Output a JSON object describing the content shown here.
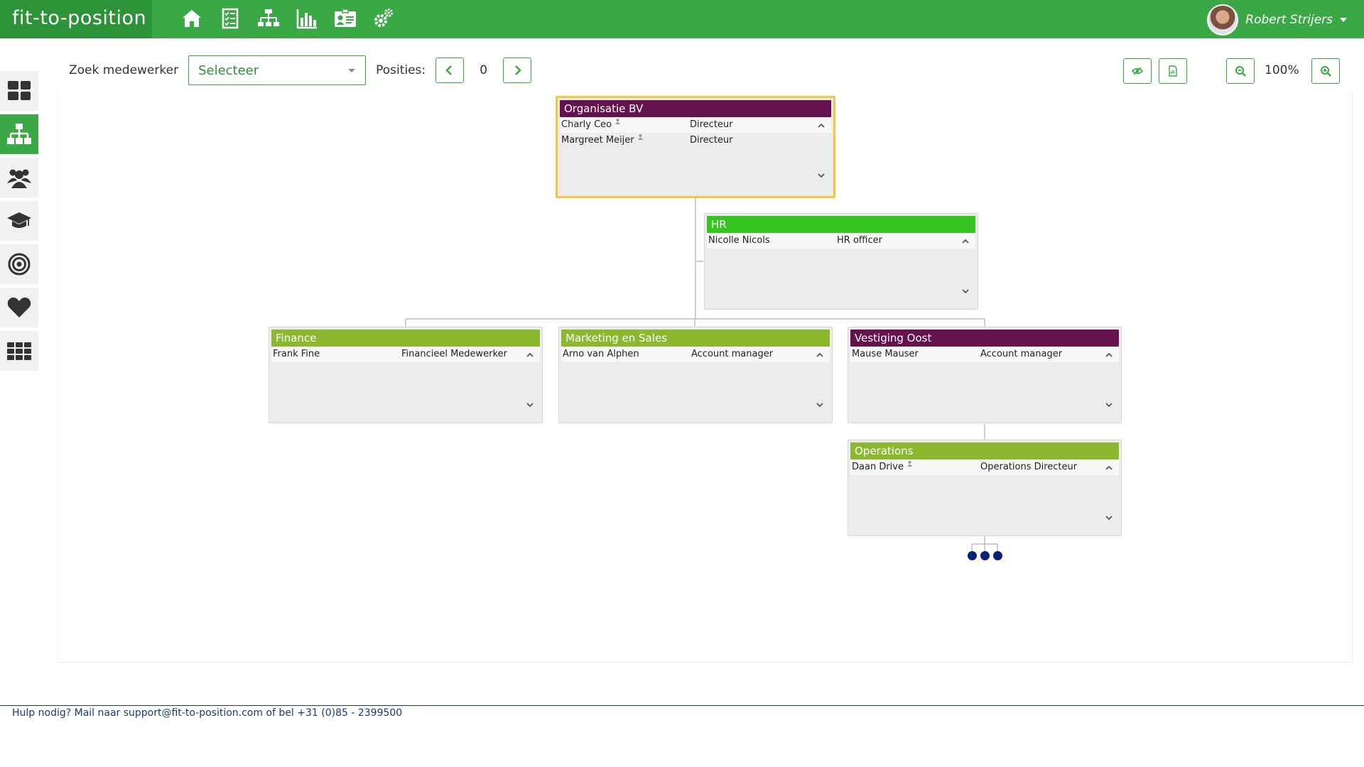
{
  "app": {
    "logo_text": "fit-to-position",
    "accent": "#3aa845",
    "accent_dark": "#2c9338"
  },
  "top_nav": {
    "icons": [
      "home-icon",
      "checklist-icon",
      "orgchart-icon",
      "bar-chart-icon",
      "id-card-icon",
      "gears-icon"
    ]
  },
  "user": {
    "name": "Robert Strijers"
  },
  "sidebar": {
    "items": [
      {
        "icon": "dashboard-icon",
        "active": false
      },
      {
        "icon": "sitemap-icon",
        "active": true
      },
      {
        "icon": "users-icon",
        "active": false
      },
      {
        "icon": "graduation-cap-icon",
        "active": false
      },
      {
        "icon": "target-icon",
        "active": false
      },
      {
        "icon": "heart-icon",
        "active": false
      },
      {
        "icon": "grid-icon",
        "active": false
      }
    ]
  },
  "toolbar": {
    "search_label": "Zoek medewerker",
    "select_value": "Selecteer",
    "positions_label": "Posities:",
    "positions_value": "0",
    "zoom_value": "100%"
  },
  "org_units": [
    {
      "name": "Organisatie BV",
      "color": "#66124f",
      "selected": true,
      "rows": [
        {
          "name": "Charly Ceo",
          "role": "Directeur",
          "person_icon": true
        },
        {
          "name": "Margreet Meijer",
          "role": "Directeur",
          "person_icon": true
        }
      ]
    },
    {
      "name": "HR",
      "color": "#36c420",
      "selected": false,
      "rows": [
        {
          "name": "Nicolle Nicols",
          "role": "HR officer",
          "person_icon": false
        }
      ]
    },
    {
      "name": "Finance",
      "color": "#8cb830",
      "selected": false,
      "rows": [
        {
          "name": "Frank Fine",
          "role": "Financieel Medewerker",
          "person_icon": false
        }
      ]
    },
    {
      "name": "Marketing en Sales",
      "color": "#8cb830",
      "selected": false,
      "rows": [
        {
          "name": "Arno van Alphen",
          "role": "Account manager",
          "person_icon": false
        }
      ]
    },
    {
      "name": "Vestiging Oost",
      "color": "#66124f",
      "selected": false,
      "rows": [
        {
          "name": "Mause Mauser",
          "role": "Account manager",
          "person_icon": false
        }
      ]
    },
    {
      "name": "Operations",
      "color": "#8cb830",
      "selected": false,
      "rows": [
        {
          "name": "Daan Drive",
          "role": "Operations Directeur",
          "person_icon": true
        }
      ]
    }
  ],
  "footer": {
    "text": "Hulp nodig? Mail naar support@fit-to-position.com of bel +31 (0)85 - 2399500"
  }
}
